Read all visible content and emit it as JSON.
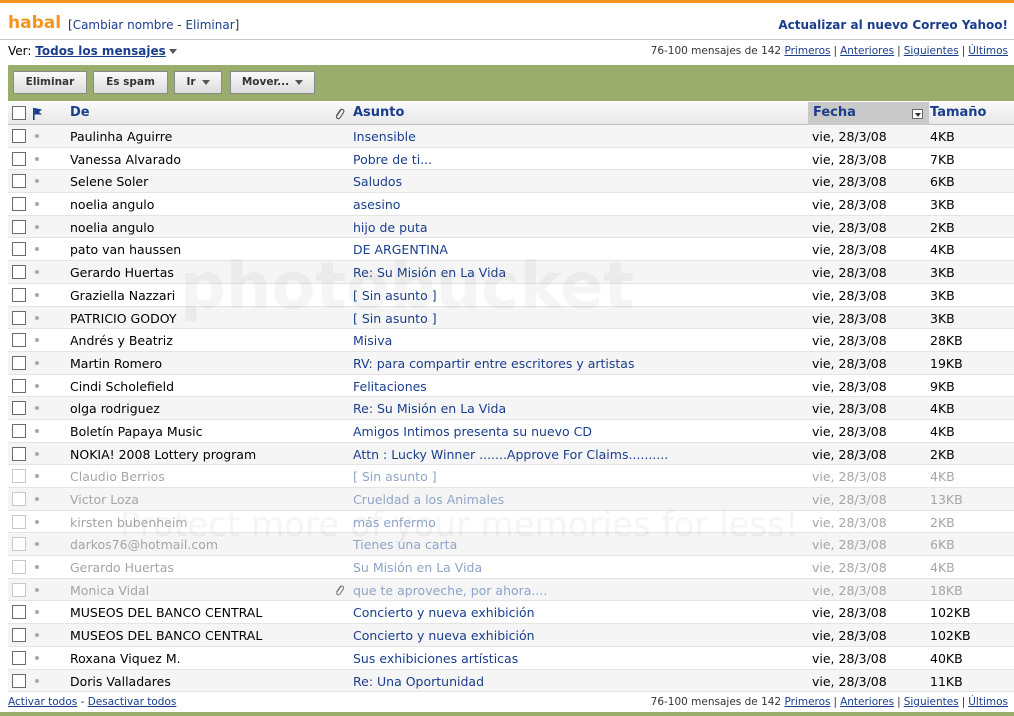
{
  "header": {
    "folder": "habal",
    "bracket_open": "[",
    "rename": "Cambiar nombre",
    "dash": "-",
    "delete": "Eliminar",
    "bracket_close": "]",
    "upgrade": "Actualizar al nuevo Correo Yahoo!"
  },
  "view": {
    "label": "Ver:",
    "selected": "Todos los mensajes"
  },
  "pager": {
    "range": "76-100 mensajes de 142",
    "first": "Primeros",
    "prev": "Anteriores",
    "next": "Siguientes",
    "last": "Últimos"
  },
  "toolbar": {
    "delete": "Eliminar",
    "spam": "Es spam",
    "go": "Ir",
    "move": "Mover..."
  },
  "columns": {
    "from": "De",
    "subject": "Asunto",
    "date": "Fecha",
    "size": "Tamaño"
  },
  "messages": [
    {
      "from": "Paulinha Aguirre",
      "subject": "Insensible",
      "date": "vie, 28/3/08",
      "size": "4KB",
      "read": false,
      "attach": false
    },
    {
      "from": "Vanessa Alvarado",
      "subject": "Pobre de ti...",
      "date": "vie, 28/3/08",
      "size": "7KB",
      "read": false,
      "attach": false
    },
    {
      "from": "Selene Soler",
      "subject": "Saludos",
      "date": "vie, 28/3/08",
      "size": "6KB",
      "read": false,
      "attach": false
    },
    {
      "from": "noelia angulo",
      "subject": "asesino",
      "date": "vie, 28/3/08",
      "size": "3KB",
      "read": false,
      "attach": false
    },
    {
      "from": "noelia angulo",
      "subject": "hijo de puta",
      "date": "vie, 28/3/08",
      "size": "2KB",
      "read": false,
      "attach": false
    },
    {
      "from": "pato van haussen",
      "subject": "DE ARGENTINA",
      "date": "vie, 28/3/08",
      "size": "4KB",
      "read": false,
      "attach": false
    },
    {
      "from": "Gerardo Huertas",
      "subject": "Re: Su Misión en La Vida",
      "date": "vie, 28/3/08",
      "size": "3KB",
      "read": false,
      "attach": false
    },
    {
      "from": "Graziella Nazzari",
      "subject": "[ Sin asunto ]",
      "date": "vie, 28/3/08",
      "size": "3KB",
      "read": false,
      "attach": false
    },
    {
      "from": "PATRICIO GODOY",
      "subject": "[ Sin asunto ]",
      "date": "vie, 28/3/08",
      "size": "3KB",
      "read": false,
      "attach": false
    },
    {
      "from": "Andrés y Beatriz",
      "subject": "Misiva",
      "date": "vie, 28/3/08",
      "size": "28KB",
      "read": false,
      "attach": false
    },
    {
      "from": "Martin Romero",
      "subject": "RV: para compartir entre escritores y artistas",
      "date": "vie, 28/3/08",
      "size": "19KB",
      "read": false,
      "attach": false
    },
    {
      "from": "Cindi Scholefield",
      "subject": "Felitaciones",
      "date": "vie, 28/3/08",
      "size": "9KB",
      "read": false,
      "attach": false
    },
    {
      "from": "olga rodriguez",
      "subject": "Re: Su Misión en La Vida",
      "date": "vie, 28/3/08",
      "size": "4KB",
      "read": false,
      "attach": false
    },
    {
      "from": "Boletín Papaya Music",
      "subject": "Amigos Intimos presenta su nuevo CD",
      "date": "vie, 28/3/08",
      "size": "4KB",
      "read": false,
      "attach": false
    },
    {
      "from": "NOKIA! 2008 Lottery program",
      "subject": "Attn : Lucky Winner .......Approve For Claims..........",
      "date": "vie, 28/3/08",
      "size": "2KB",
      "read": false,
      "attach": false
    },
    {
      "from": "Claudio Berrios",
      "subject": "[ Sin asunto ]",
      "date": "vie, 28/3/08",
      "size": "4KB",
      "read": true,
      "attach": false
    },
    {
      "from": "Victor Loza",
      "subject": "Crueldad a los Animales",
      "date": "vie, 28/3/08",
      "size": "13KB",
      "read": true,
      "attach": false
    },
    {
      "from": "kirsten bubenheim",
      "subject": "más enfermo",
      "date": "vie, 28/3/08",
      "size": "2KB",
      "read": true,
      "attach": false
    },
    {
      "from": "darkos76@hotmail.com",
      "subject": "Tienes una carta",
      "date": "vie, 28/3/08",
      "size": "6KB",
      "read": true,
      "attach": false
    },
    {
      "from": "Gerardo Huertas",
      "subject": "Su Misión en La Vida",
      "date": "vie, 28/3/08",
      "size": "4KB",
      "read": true,
      "attach": false
    },
    {
      "from": "Monica Vidal",
      "subject": "que te aproveche, por ahora....",
      "date": "vie, 28/3/08",
      "size": "18KB",
      "read": true,
      "attach": true
    },
    {
      "from": "MUSEOS DEL BANCO CENTRAL",
      "subject": "Concierto y nueva exhibición",
      "date": "vie, 28/3/08",
      "size": "102KB",
      "read": false,
      "attach": false
    },
    {
      "from": "MUSEOS DEL BANCO CENTRAL",
      "subject": "Concierto y nueva exhibición",
      "date": "vie, 28/3/08",
      "size": "102KB",
      "read": false,
      "attach": false
    },
    {
      "from": "Roxana Viquez M.",
      "subject": "Sus exhibiciones artísticas",
      "date": "vie, 28/3/08",
      "size": "40KB",
      "read": false,
      "attach": false
    },
    {
      "from": "Doris Valladares",
      "subject": "Re: Una Oportunidad",
      "date": "vie, 28/3/08",
      "size": "11KB",
      "read": false,
      "attach": false
    }
  ],
  "footer": {
    "select_all": "Activar todos",
    "dash": "-",
    "deselect_all": "Desactivar todos"
  },
  "watermark": {
    "line1": "photobucket",
    "line2": "Protect more of your memories for less!"
  }
}
